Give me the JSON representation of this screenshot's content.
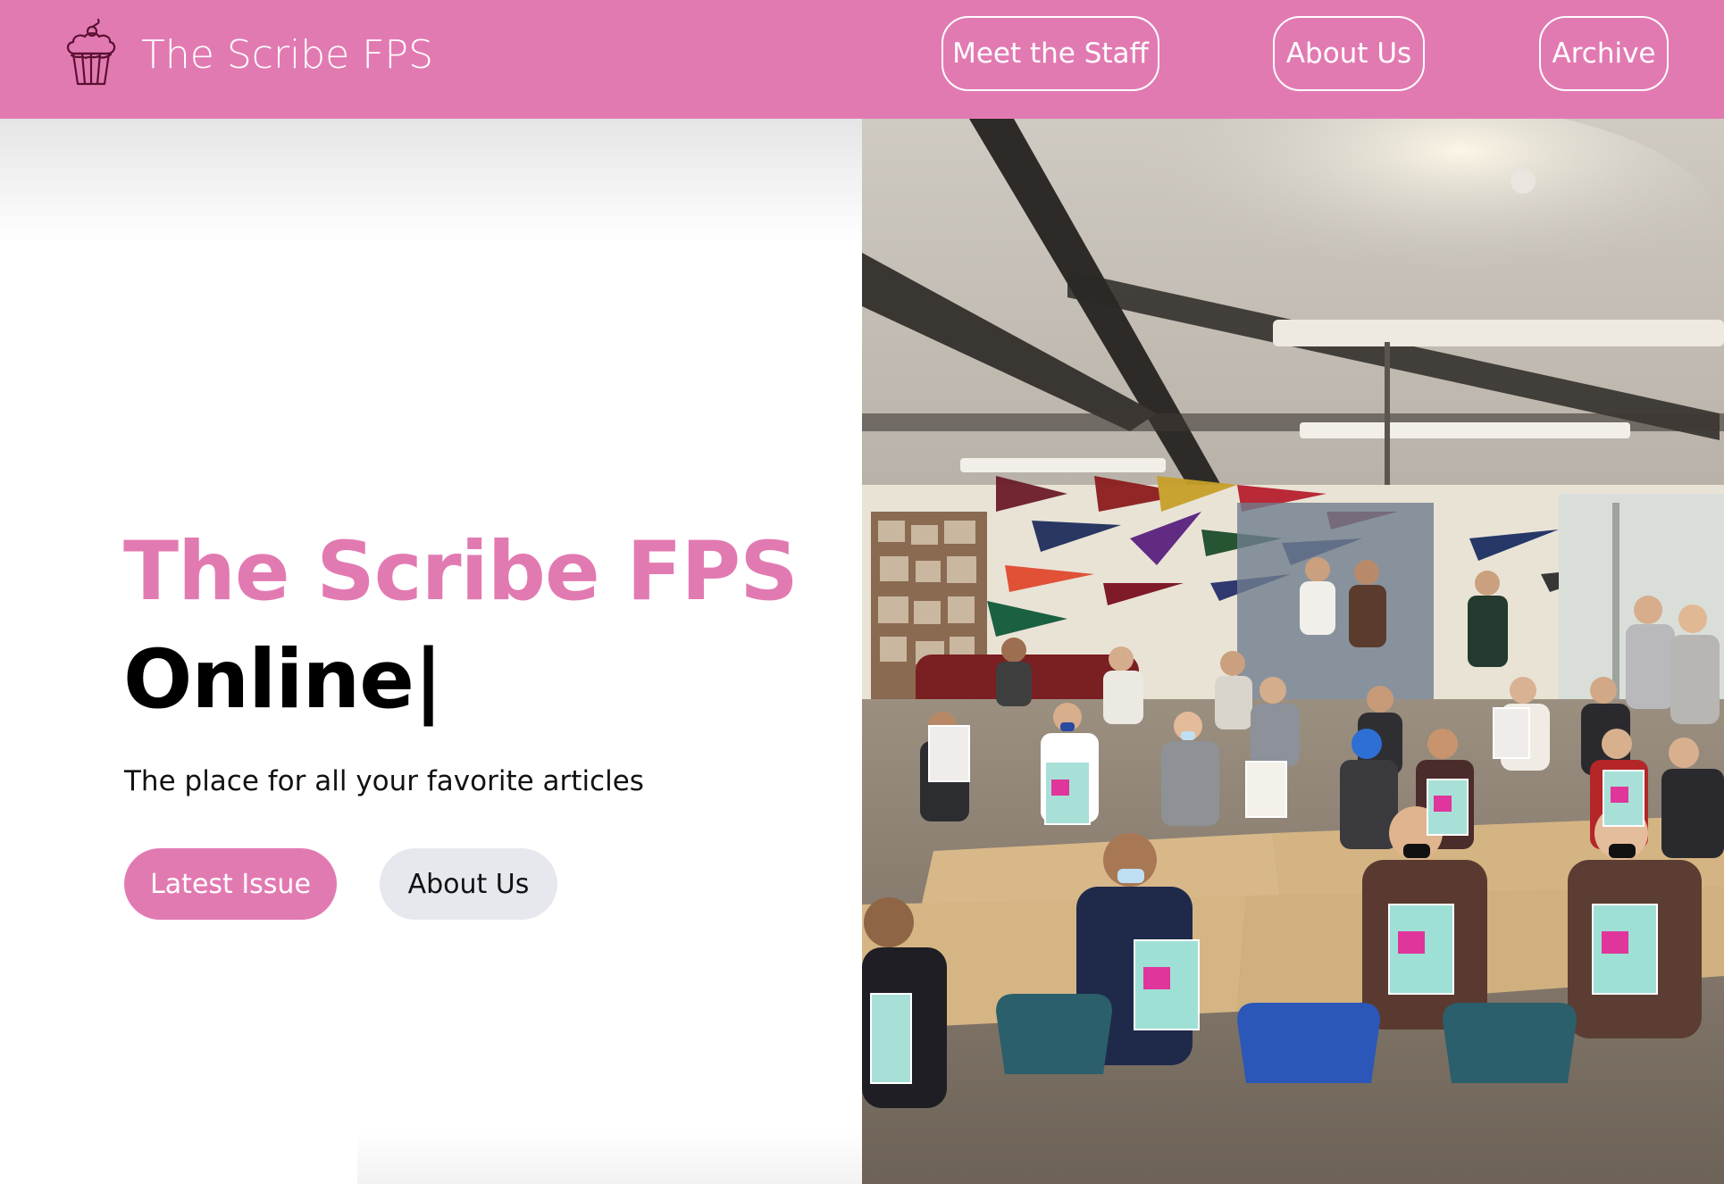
{
  "navbar": {
    "brand_text": "The Scribe FPS",
    "logo_icon": "cupcake-icon",
    "background": "#e27ab2",
    "links": [
      {
        "label": "Meet the Staff"
      },
      {
        "label": "About Us"
      },
      {
        "label": "Archive"
      }
    ]
  },
  "hero": {
    "title": "The Scribe FPS",
    "typed_text": "Online",
    "cursor": "|",
    "subtitle": "The place for all your favorite articles",
    "primary_button": "Latest Issue",
    "secondary_button": "About Us",
    "accent_color": "#e27ab2"
  }
}
